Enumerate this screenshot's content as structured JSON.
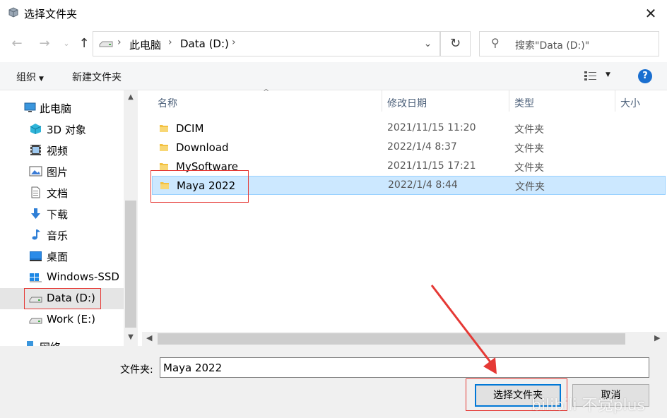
{
  "window": {
    "title": "选择文件夹"
  },
  "address": {
    "crumbs": [
      "此电脑",
      "Data (D:)"
    ]
  },
  "search": {
    "placeholder": "搜索\"Data (D:)\""
  },
  "toolbar": {
    "organize": "组织",
    "new_folder": "新建文件夹"
  },
  "sidebar": {
    "items": [
      {
        "label": "此电脑",
        "icon": "pc-icon"
      },
      {
        "label": "3D 对象",
        "icon": "cube-icon"
      },
      {
        "label": "视频",
        "icon": "video-icon"
      },
      {
        "label": "图片",
        "icon": "picture-icon"
      },
      {
        "label": "文档",
        "icon": "document-icon"
      },
      {
        "label": "下载",
        "icon": "download-icon"
      },
      {
        "label": "音乐",
        "icon": "music-icon"
      },
      {
        "label": "桌面",
        "icon": "desktop-icon"
      },
      {
        "label": "Windows-SSD (",
        "icon": "windows-drive-icon"
      },
      {
        "label": "Data (D:)",
        "icon": "drive-icon",
        "selected": true
      },
      {
        "label": "Work (E:)",
        "icon": "drive-icon"
      },
      {
        "label": "网络",
        "icon": "network-icon"
      }
    ]
  },
  "columns": [
    "名称",
    "修改日期",
    "类型",
    "大小"
  ],
  "files": [
    {
      "name": "DCIM",
      "date": "2021/11/15 11:20",
      "type": "文件夹"
    },
    {
      "name": "Download",
      "date": "2022/1/4 8:37",
      "type": "文件夹"
    },
    {
      "name": "MySoftware",
      "date": "2021/11/15 17:21",
      "type": "文件夹"
    },
    {
      "name": "Maya 2022",
      "date": "2022/1/4 8:44",
      "type": "文件夹",
      "selected": true
    }
  ],
  "footer": {
    "folder_label": "文件夹:",
    "folder_value": "Maya 2022",
    "select_button": "选择文件夹",
    "cancel_button": "取消"
  },
  "watermark": "bilibili 不觉plus",
  "colors": {
    "selection": "#cce8ff",
    "accent": "#0078d7",
    "annotation": "#e53935",
    "folder": "#f3c141"
  }
}
